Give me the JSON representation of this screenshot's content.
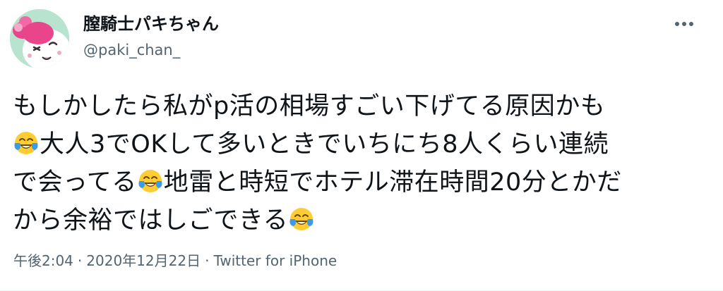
{
  "author": {
    "display_name": "膣騎士パキちゃん",
    "handle": "@paki_chan_"
  },
  "more_icon": "ellipsis-icon",
  "tweet": {
    "lines": [
      {
        "segments": [
          {
            "text": "もしかしたら私がp活の相場すごい下げてる原因かも"
          }
        ]
      },
      {
        "segments": [
          {
            "emoji": "joy-tears"
          },
          {
            "text": "大人3でOKして多いときでいちにち8人くらい連続"
          }
        ]
      },
      {
        "segments": [
          {
            "text": "で会ってる"
          },
          {
            "emoji": "joy-tears"
          },
          {
            "text": "地雷と時短でホテル滞在時間20分とかだ"
          }
        ]
      },
      {
        "segments": [
          {
            "text": "から余裕ではしごできる"
          },
          {
            "emoji": "joy-tears"
          }
        ]
      }
    ]
  },
  "meta": {
    "time": "午後2:04",
    "separator": "·",
    "date": "2020年12月22日",
    "source": "Twitter for iPhone"
  },
  "colors": {
    "text": "#0f1419",
    "secondary": "#536471",
    "avatar_bg": "#b8e3ce",
    "emoji_face": "#ffcc33",
    "emoji_tear": "#3b9be8"
  }
}
